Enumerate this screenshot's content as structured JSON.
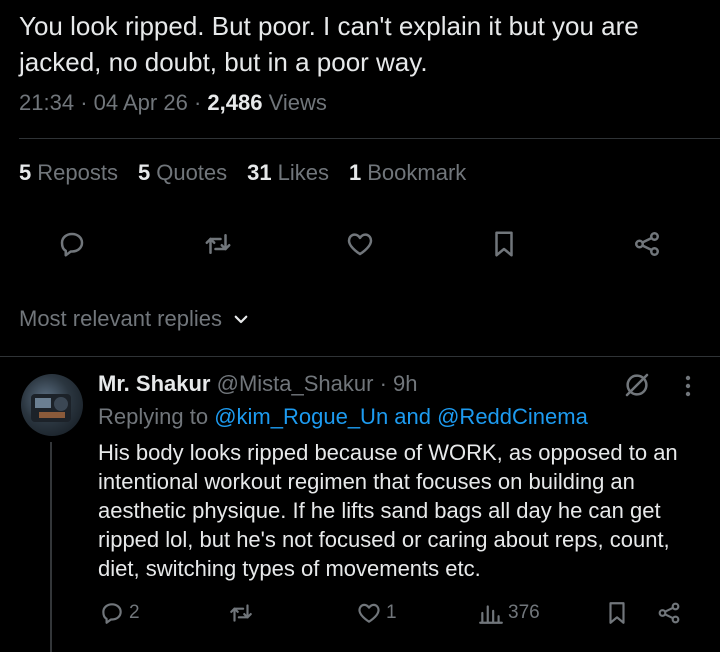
{
  "tweet": {
    "text": "You look ripped. But poor. I can't explain it but you are jacked, no doubt,  but in a poor way.",
    "time": "21:34",
    "date": "04 Apr 26",
    "views_count": "2,486",
    "views_label": "Views"
  },
  "stats": {
    "reposts_count": "5",
    "reposts_label": "Reposts",
    "quotes_count": "5",
    "quotes_label": "Quotes",
    "likes_count": "31",
    "likes_label": "Likes",
    "bookmarks_count": "1",
    "bookmarks_label": "Bookmark"
  },
  "replies_filter": {
    "label": "Most relevant replies"
  },
  "reply": {
    "name": "Mr. Shakur",
    "handle": "@Mista_Shakur",
    "time": "9h",
    "replying_prefix": "Replying to",
    "replying_targets": "@kim_Rogue_Un and @ReddCinema",
    "text": "His body looks ripped because of WORK, as opposed to an intentional workout regimen that focuses on building an aesthetic physique. If he lifts sand bags all day he can get ripped lol, but he's not focused or caring about reps, count, diet, switching types of movements etc.",
    "replies_count": "2",
    "likes_count": "1",
    "views_count": "376"
  },
  "colors": {
    "accent": "#1d9bf0",
    "muted": "#71767b",
    "text": "#e7e9ea",
    "background": "#000000",
    "border": "#2f3336"
  }
}
